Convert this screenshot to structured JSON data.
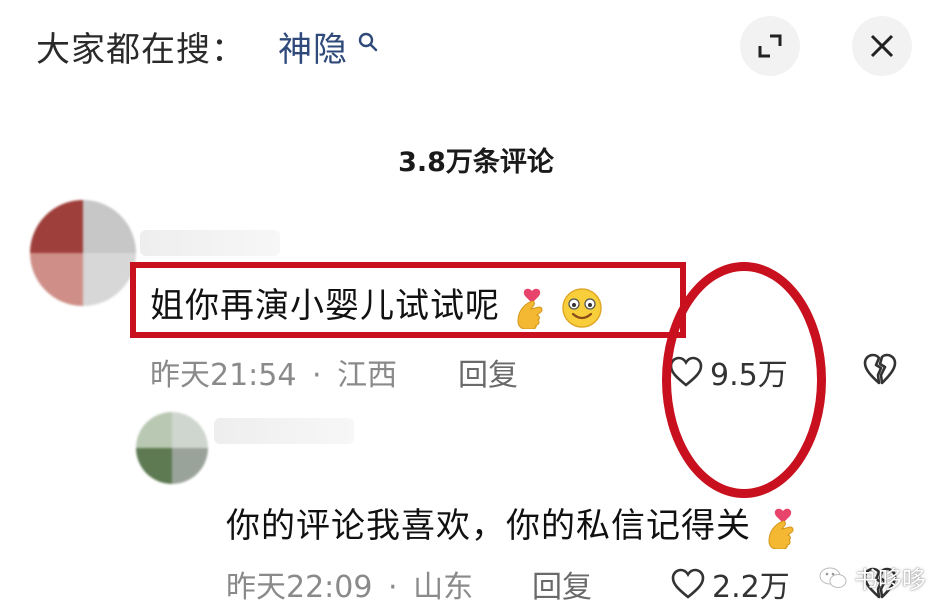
{
  "search": {
    "prefix": "大家都在搜：",
    "term": "神隐"
  },
  "header": {
    "comment_count": "3.8万条评论"
  },
  "comments": [
    {
      "text": "姐你再演小婴儿试试呢",
      "time": "昨天21:54",
      "location": "江西",
      "reply_label": "回复",
      "likes": "9.5万",
      "emojis": [
        "finger-heart-emoji",
        "smile-emoji"
      ]
    },
    {
      "text": "你的评论我喜欢，你的私信记得关",
      "time": "昨天22:09",
      "location": "山东",
      "reply_label": "回复",
      "likes": "2.2万",
      "emojis": [
        "finger-heart-emoji"
      ]
    }
  ],
  "separator": "·",
  "watermark": "书哆哆",
  "colors": {
    "highlight_red": "#c8101f",
    "search_term": "#2f4a7a",
    "meta_gray": "#8a8a8a"
  }
}
